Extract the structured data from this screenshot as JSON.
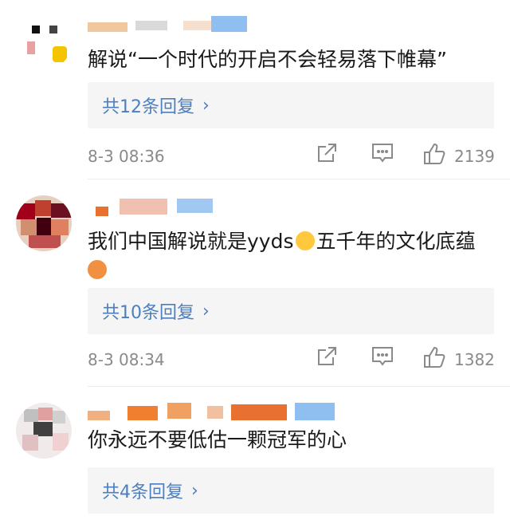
{
  "comments": [
    {
      "text": "解说“一个时代的开启不会轻易落下帷幕”",
      "replies_label": "共12条回复",
      "timestamp": "8-3 08:36",
      "like_count": "2139"
    },
    {
      "text_part1": "我们中国解说就是yyds",
      "text_part2": "五千年的文化底蕴",
      "replies_label": "共10条回复",
      "timestamp": "8-3 08:34",
      "like_count": "1382"
    },
    {
      "text": "你永远不要低估一颗冠军的心",
      "replies_label": "共4条回复"
    }
  ],
  "icons": {
    "share": "share-icon",
    "comment": "comment-icon",
    "like": "thumbs-up-icon",
    "chevron": "chevron-right-icon"
  },
  "colors": {
    "link": "#4d7fbf",
    "meta": "#8a8a8a",
    "reply_bg": "#f5f5f5"
  }
}
